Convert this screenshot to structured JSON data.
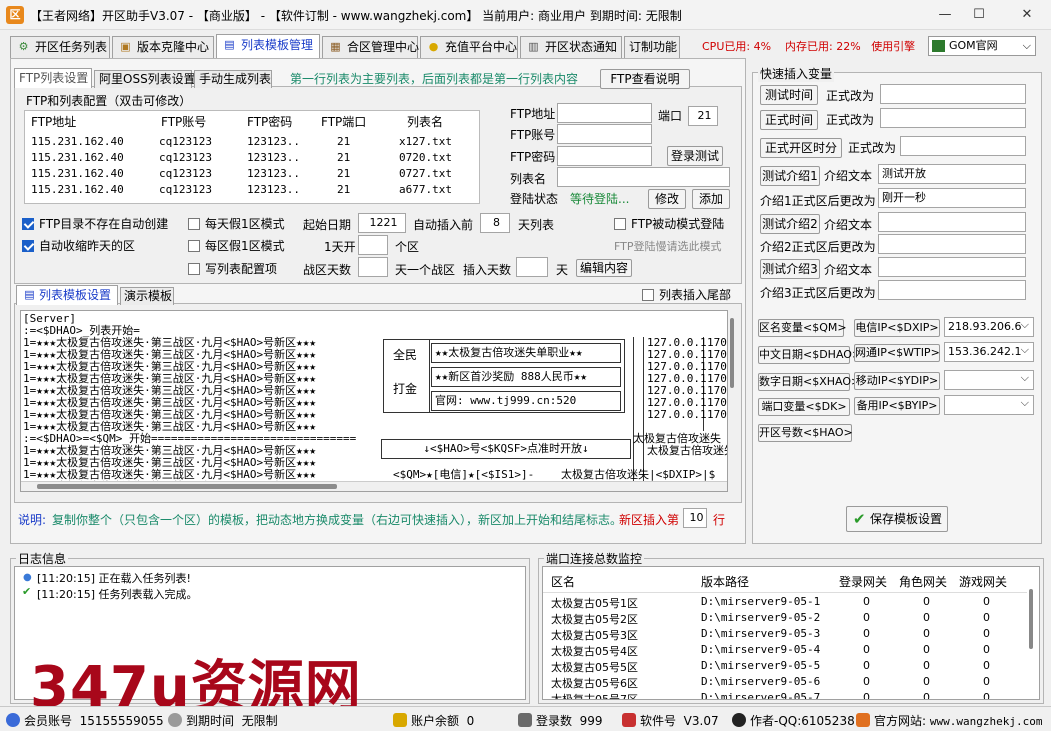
{
  "window": {
    "title": "【王者网络】开区助手V3.07 - 【商业版】 - 【软件订制 - www.wangzhekj.com】 当前用户: 商业用户  到期时间: 无限制",
    "logo": "区"
  },
  "tabs": [
    "开区任务列表",
    "版本克隆中心",
    "列表模板管理",
    "合区管理中心",
    "充值平台中心",
    "开区状态通知",
    "订制功能"
  ],
  "top_status": {
    "cpu": "CPU已用: 4%",
    "mem": "内存已用: 22%",
    "engine": "使用引擎",
    "engine_value": "GOM官网"
  },
  "subtabs": [
    "FTP列表设置",
    "阿里OSS列表设置",
    "手动生成列表"
  ],
  "hint_main": "第一行列表为主要列表，后面列表都是第一行列表内容",
  "btn_ftp_help": "FTP查看说明",
  "ftp_group_title": "FTP和列表配置（双击可修改）",
  "ftp_headers": [
    "FTP地址",
    "FTP账号",
    "FTP密码",
    "FTP端口",
    "列表名"
  ],
  "ftp_rows": [
    [
      "115.231.162.40",
      "cq123123",
      "123123..",
      "21",
      "x127.txt"
    ],
    [
      "115.231.162.40",
      "cq123123",
      "123123..",
      "21",
      "0720.txt"
    ],
    [
      "115.231.162.40",
      "cq123123",
      "123123..",
      "21",
      "0727.txt"
    ],
    [
      "115.231.162.40",
      "cq123123",
      "123123..",
      "21",
      "a677.txt"
    ]
  ],
  "ftp_form": {
    "addr_label": "FTP地址",
    "port_label": "端口",
    "port_value": "21",
    "account_label": "FTP账号",
    "password_label": "FTP密码",
    "login_test": "登录测试",
    "list_label": "列表名",
    "login_status_label": "登陆状态",
    "login_status_value": "等待登陆...",
    "modify": "修改",
    "add": "添加"
  },
  "options": {
    "auto_create": "FTP目录不存在自动创建",
    "auto_shrink": "自动收缩昨天的区",
    "fake_day": "每天假1区模式",
    "fake_zone": "每区假1区模式",
    "write_cfg": "写列表配置项",
    "start_date_label": "起始日期",
    "start_date": "1221",
    "auto_insert_label": "自动插入前",
    "auto_insert": "8",
    "auto_insert_unit": "天列表",
    "one_day_label": "1天开",
    "one_day_unit": "个区",
    "war_days_label": "战区天数",
    "war_days_unit": "天一个战区",
    "insert_days_label": "插入天数",
    "insert_days_unit": "天",
    "edit_content": "编辑内容",
    "passive": "FTP被动模式登陆",
    "passive_hint": "FTP登陆慢请选此模式"
  },
  "template_tabs": [
    "列表模板设置",
    "演示模板"
  ],
  "append_tail": "列表插入尾部",
  "template_lines": [
    "[Server]",
    ":=<$DHAO>_列表开始=",
    "1=★★★太极复古倍攻迷失·第三战区·九月<$HAO>号新区★★★",
    "1=★★★太极复古倍攻迷失·第三战区·九月<$HAO>号新区★★★",
    "1=★★★太极复古倍攻迷失·第三战区·九月<$HAO>号新区★★★",
    "1=★★★太极复古倍攻迷失·第三战区·九月<$HAO>号新区★★★",
    "1=★★★太极复古倍攻迷失·第三战区·九月<$HAO>号新区★★★",
    "1=★★★太极复古倍攻迷失·第三战区·九月<$HAO>号新区★★★",
    "1=★★★太极复古倍攻迷失·第三战区·九月<$HAO>号新区★★★",
    "1=★★★太极复古倍攻迷失·第三战区·九月<$HAO>号新区★★★",
    ":=<$DHAO>=<$QM>_开始===============================",
    "1=★★★太极复古倍攻迷失·第三战区·九月<$HAO>号新区★★★",
    "1=★★★太极复古倍攻迷失·第三战区·九月<$HAO>号新区★★★",
    "1=★★★太极复古倍攻迷失·第三战区·九月<$HAO>号新区★★★",
    "1=★★★太极复古倍攻迷失·第三战区·九月<$HAO>号新区★★★",
    "1=★★★太极复古倍攻迷失·第三战区·九月<$HAO>号新区★★★",
    "1=★★★太极复古倍攻迷失·第三战区·九月<$HAO>号新区★★★"
  ],
  "template_box": {
    "c1a": "全民",
    "c1b": "打金",
    "r1": "★★太极复古倍攻迷失单职业★★",
    "r2": "★★新区首沙奖励 888人民币★★",
    "r3": "官网:   www.tj999.cn:520",
    "ip": "127.0.0.1",
    "port": "170",
    "r4": "↓<$HAO>号<$KQSF>点准时开放↓",
    "r5": "太极复古倍攻迷失",
    "r6": "<$QM>★[电信]★[<$IS1>]-",
    "r7": "太极复古倍攻迷失|<$DXIP>|$"
  },
  "explain": {
    "label": "说明:",
    "text": "复制你整个（只包含一个区）的模板，把动态地方换成变量（右边可快速插入），新区加上开始和结尾标志。",
    "insert_label": "新区插入第",
    "insert_value": "10",
    "insert_unit": "行"
  },
  "quick": {
    "title": "快速插入变量",
    "test_time": "测试时间",
    "formal_to": "正式改为",
    "formal_time": "正式时间",
    "formal_open": "正式开区时分",
    "intro1_btn": "测试介绍1",
    "intro_text": "介绍文本",
    "intro1_value": "测试开放",
    "intro1_after": "介绍1正式区后更改为",
    "intro1_after_value": "刚开一秒",
    "intro2_btn": "测试介绍2",
    "intro2_after": "介绍2正式区后更改为",
    "intro3_btn": "测试介绍3",
    "intro3_after": "介绍3正式区后更改为",
    "zone_var": "区名变量<$QM>",
    "dx_ip": "电信IP<$DXIP>",
    "dx_ip_value": "218.93.206.6",
    "cn_date": "中文日期<$DHAO>",
    "wt_ip": "网通IP<$WTIP>",
    "wt_ip_value": "153.36.242.1",
    "num_date": "数字日期<$XHAO>",
    "yd_ip": "移动IP<$YDIP>",
    "port_var": "端口变量<$DK>",
    "by_ip": "备用IP<$BYIP>",
    "zone_num": "开区号数<$HAO>",
    "save": "保存模板设置"
  },
  "log": {
    "title": "日志信息",
    "lines": [
      "[11:20:15] 正在载入任务列表!",
      "[11:20:15] 任务列表载入完成。"
    ]
  },
  "ports": {
    "title": "端口连接总数监控",
    "headers": [
      "区名",
      "版本路径",
      "登录网关",
      "角色网关",
      "游戏网关"
    ],
    "rows": [
      [
        "太极复古05号1区",
        "D:\\mirserver9-05-1",
        "0",
        "0",
        "0"
      ],
      [
        "太极复古05号2区",
        "D:\\mirserver9-05-2",
        "0",
        "0",
        "0"
      ],
      [
        "太极复古05号3区",
        "D:\\mirserver9-05-3",
        "0",
        "0",
        "0"
      ],
      [
        "太极复古05号4区",
        "D:\\mirserver9-05-4",
        "0",
        "0",
        "0"
      ],
      [
        "太极复古05号5区",
        "D:\\mirserver9-05-5",
        "0",
        "0",
        "0"
      ],
      [
        "太极复古05号6区",
        "D:\\mirserver9-05-6",
        "0",
        "0",
        "0"
      ],
      [
        "太极复古05号7区",
        "D:\\mirserver9-05-7",
        "0",
        "0",
        "0"
      ]
    ]
  },
  "status": {
    "account_label": "会员账号",
    "account": "15155559055",
    "expire_label": "到期时间",
    "expire": "无限制",
    "balance_label": "账户余额",
    "balance": "0",
    "logins_label": "登录数",
    "logins": "999",
    "version_label": "软件号",
    "version": "V3.07",
    "author": "作者-QQ:6105238",
    "site_label": "官方网站:",
    "site": "www.wangzhekj.com"
  },
  "watermark": "347u资源网"
}
